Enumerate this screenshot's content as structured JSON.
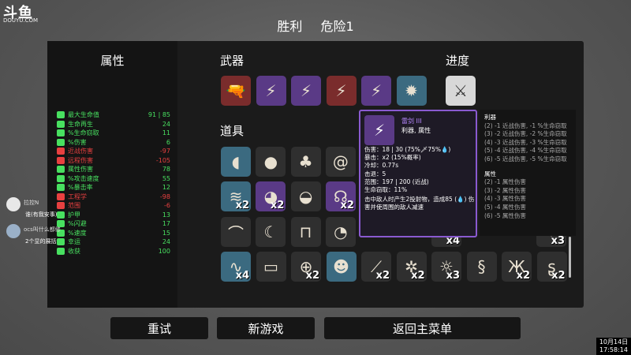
{
  "overlay": {
    "logo": "斗鱼",
    "logo_sub": "DOUYU.COM",
    "clock_date": "10月14日",
    "clock_time": "17:58:14"
  },
  "header": {
    "result": "胜利",
    "difficulty": "危险1"
  },
  "sections": {
    "stats": "属性",
    "weapons": "武器",
    "items": "道具",
    "progress": "进度"
  },
  "stats": [
    {
      "name": "最大生命值",
      "value": "91 | 85",
      "color": "#48e060"
    },
    {
      "name": "生命再生",
      "value": "24",
      "color": "#48e060"
    },
    {
      "name": "%生命窃取",
      "value": "11",
      "color": "#48e060"
    },
    {
      "name": "%伤害",
      "value": "6",
      "color": "#48e060"
    },
    {
      "name": "近战伤害",
      "value": "-97",
      "color": "#e84040"
    },
    {
      "name": "远程伤害",
      "value": "-105",
      "color": "#e84040"
    },
    {
      "name": "属性伤害",
      "value": "78",
      "color": "#48e060"
    },
    {
      "name": "%攻击速度",
      "value": "55",
      "color": "#48e060"
    },
    {
      "name": "%暴击率",
      "value": "12",
      "color": "#48e060"
    },
    {
      "name": "工程学",
      "value": "-98",
      "color": "#e84040"
    },
    {
      "name": "范围",
      "value": "-6",
      "color": "#e84040"
    },
    {
      "name": "护甲",
      "value": "13",
      "color": "#48e060"
    },
    {
      "name": "%闪避",
      "value": "17",
      "color": "#48e060"
    },
    {
      "name": "%速度",
      "value": "15",
      "color": "#48e060"
    },
    {
      "name": "幸运",
      "value": "24",
      "color": "#48e060"
    },
    {
      "name": "收获",
      "value": "100",
      "color": "#48e060"
    }
  ],
  "weapons": [
    {
      "icon": "gun-icon",
      "tier": "red"
    },
    {
      "icon": "wand-icon",
      "tier": "purple"
    },
    {
      "icon": "wand-icon",
      "tier": "purple"
    },
    {
      "icon": "wand-icon",
      "tier": "red"
    },
    {
      "icon": "wand-icon",
      "tier": "purple"
    },
    {
      "icon": "blaster-icon",
      "tier": "blue"
    }
  ],
  "progress_item": {
    "icon": "sword-icon",
    "tier": "white"
  },
  "items_row1": [
    {
      "icon": "bottle-icon",
      "tier": "blue",
      "count": ""
    },
    {
      "icon": "rock-icon",
      "tier": "gray",
      "count": ""
    },
    {
      "icon": "plant-icon",
      "tier": "gray",
      "count": ""
    },
    {
      "icon": "spiral-icon",
      "tier": "gray",
      "count": ""
    }
  ],
  "items_row2": [
    {
      "icon": "scroll-icon",
      "tier": "blue",
      "count": "x2"
    },
    {
      "icon": "creature-icon",
      "tier": "purple",
      "count": "x2"
    },
    {
      "icon": "cap-icon",
      "tier": "gray",
      "count": ""
    },
    {
      "icon": "ghost-icon",
      "tier": "purple",
      "count": "x2"
    }
  ],
  "items_row3": [
    {
      "icon": "claw-icon",
      "tier": "gray",
      "count": ""
    },
    {
      "icon": "horn-icon",
      "tier": "gray",
      "count": ""
    },
    {
      "icon": "jar-icon",
      "tier": "gray",
      "count": ""
    },
    {
      "icon": "slime-icon",
      "tier": "gray",
      "count": ""
    }
  ],
  "items_row4": [
    {
      "icon": "grub-icon",
      "tier": "blue",
      "count": "x4"
    },
    {
      "icon": "ticket-icon",
      "tier": "gray",
      "count": ""
    },
    {
      "icon": "potion-icon",
      "tier": "gray",
      "count": "x2"
    },
    {
      "icon": "frog-icon",
      "tier": "blue",
      "count": ""
    },
    {
      "icon": "knife-icon",
      "tier": "gray",
      "count": "x2"
    },
    {
      "icon": "turret-icon",
      "tier": "gray",
      "count": "x2"
    },
    {
      "icon": "bee-icon",
      "tier": "gray",
      "count": "x3"
    },
    {
      "icon": "worm-icon",
      "tier": "gray",
      "count": ""
    },
    {
      "icon": "squid-icon",
      "tier": "gray",
      "count": "x2"
    },
    {
      "icon": "snake-icon",
      "tier": "gray",
      "count": "x2"
    }
  ],
  "hidden_counts": {
    "right_mid": "x4",
    "right_far": "x3"
  },
  "tooltip": {
    "name": "雷剑 III",
    "type": "利器, 属性",
    "lines": [
      "伤害：18 | 30 (75%🗡75%💧)",
      "暴击：x2 (15%概率)",
      "冷却：0.77s",
      "击退：5",
      "范围：197 | 200 (近战)",
      "生命窃取：11%",
      "击中敌人时产生2投射物，造成85 (💧) 伤害并使周围的敌人减速"
    ]
  },
  "side_panel": {
    "header1": "利器",
    "lines1": [
      "(2) -1 近战伤害, -1 %生命窃取",
      "(3) -2 近战伤害, -2 %生命窃取",
      "(4) -3 近战伤害, -3 %生命窃取",
      "(5) -4 近战伤害, -4 %生命窃取",
      "(6) -5 近战伤害, -5 %生命窃取"
    ],
    "header2": "属性",
    "lines2": [
      "(2) -1 属性伤害",
      "(3) -2 属性伤害",
      "(4) -3 属性伤害",
      "(5) -4 属性伤害",
      "(6) -5 属性伤害"
    ]
  },
  "chat": [
    {
      "user": "拉控N",
      "text": "谁(有我安事)"
    },
    {
      "user": "ocs叫什么都修",
      "text": "2个显的展括"
    }
  ],
  "buttons": {
    "retry": "重试",
    "new_game": "新游戏",
    "main_menu": "返回主菜单"
  }
}
